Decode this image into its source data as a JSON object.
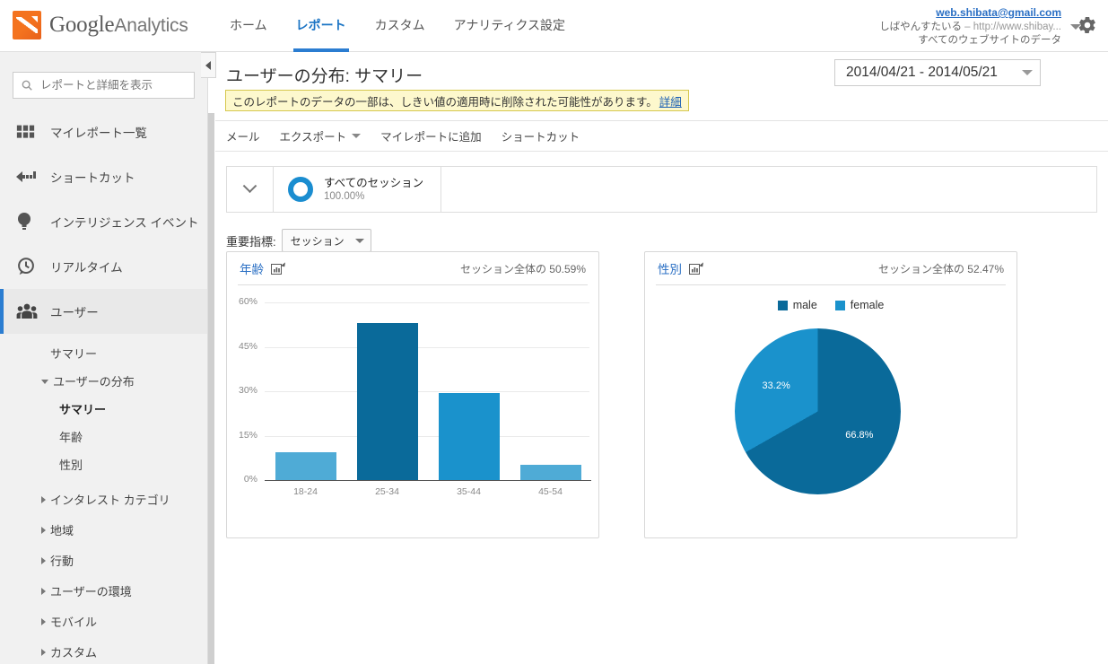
{
  "header": {
    "brand_google": "Google",
    "brand_analytics": "Analytics",
    "nav": [
      {
        "label": "ホーム",
        "active": false
      },
      {
        "label": "レポート",
        "active": true
      },
      {
        "label": "カスタム",
        "active": false
      },
      {
        "label": "アナリティクス設定",
        "active": false
      }
    ],
    "account": {
      "email": "web.shibata@gmail.com",
      "property": "しばやんすたいる",
      "separator": "–",
      "url": "http://www.shibay...",
      "view": "すべてのウェブサイトのデータ"
    }
  },
  "sidebar": {
    "search_placeholder": "レポートと詳細を表示",
    "items": [
      {
        "label": "マイレポート一覧",
        "icon": "grid-icon"
      },
      {
        "label": "ショートカット",
        "icon": "arrow-shortcut-icon"
      },
      {
        "label": "インテリジェンス イベント",
        "icon": "lightbulb-icon"
      },
      {
        "label": "リアルタイム",
        "icon": "clock-icon"
      },
      {
        "label": "ユーザー",
        "icon": "users-icon",
        "selected": true
      }
    ],
    "sub_items": [
      {
        "label": "サマリー",
        "level": 1,
        "arrow": "none",
        "bold": false
      },
      {
        "label": "ユーザーの分布",
        "level": 1,
        "arrow": "open",
        "bold": false
      },
      {
        "label": "サマリー",
        "level": 2,
        "arrow": "none",
        "bold": true
      },
      {
        "label": "年齢",
        "level": 2,
        "arrow": "none",
        "bold": false
      },
      {
        "label": "性別",
        "level": 2,
        "arrow": "none",
        "bold": false
      },
      {
        "label": "インタレスト カテゴリ",
        "level": 1,
        "arrow": "closed",
        "bold": false
      },
      {
        "label": "地域",
        "level": 1,
        "arrow": "closed",
        "bold": false
      },
      {
        "label": "行動",
        "level": 1,
        "arrow": "closed",
        "bold": false
      },
      {
        "label": "ユーザーの環境",
        "level": 1,
        "arrow": "closed",
        "bold": false
      },
      {
        "label": "モバイル",
        "level": 1,
        "arrow": "closed",
        "bold": false
      },
      {
        "label": "カスタム",
        "level": 1,
        "arrow": "closed",
        "bold": false
      }
    ]
  },
  "main": {
    "page_title": "ユーザーの分布: サマリー",
    "warning": {
      "text": "このレポートのデータの一部は、しきい値の適用時に削除された可能性があります。",
      "link": "詳細"
    },
    "date_range": "2014/04/21 - 2014/05/21",
    "toolbar": [
      {
        "label": "メール",
        "caret": false
      },
      {
        "label": "エクスポート",
        "caret": true
      },
      {
        "label": "マイレポートに追加",
        "caret": false
      },
      {
        "label": "ショートカット",
        "caret": false
      }
    ],
    "segment": {
      "name": "すべてのセッション",
      "percent": "100.00%"
    },
    "metric": {
      "label": "重要指標:",
      "value": "セッション"
    }
  },
  "chart_data": [
    {
      "type": "bar",
      "panel_title": "年齢",
      "panel_subtitle": "セッション全体の 50.59%",
      "categories": [
        "18-24",
        "25-34",
        "35-44",
        "45-54"
      ],
      "values": [
        9.5,
        53.0,
        29.5,
        5.3
      ],
      "colors": [
        "#4fabd6",
        "#0a6a9a",
        "#1a92cc",
        "#4fabd6"
      ],
      "title": "",
      "xlabel": "",
      "ylabel": "",
      "ylim": [
        0,
        60
      ],
      "yticks": [
        "0%",
        "15%",
        "30%",
        "45%",
        "60%"
      ],
      "ytick_values": [
        0,
        15,
        30,
        45,
        60
      ],
      "grid": true,
      "legend": "none"
    },
    {
      "type": "pie",
      "panel_title": "性別",
      "panel_subtitle": "セッション全体の 52.47%",
      "categories": [
        "male",
        "female"
      ],
      "values": [
        66.8,
        33.2
      ],
      "labels": [
        "66.8%",
        "33.2%"
      ],
      "colors": [
        "#0a6a9a",
        "#1a92cc"
      ],
      "legend": "top",
      "legend_entries": [
        "male",
        "female"
      ]
    }
  ]
}
